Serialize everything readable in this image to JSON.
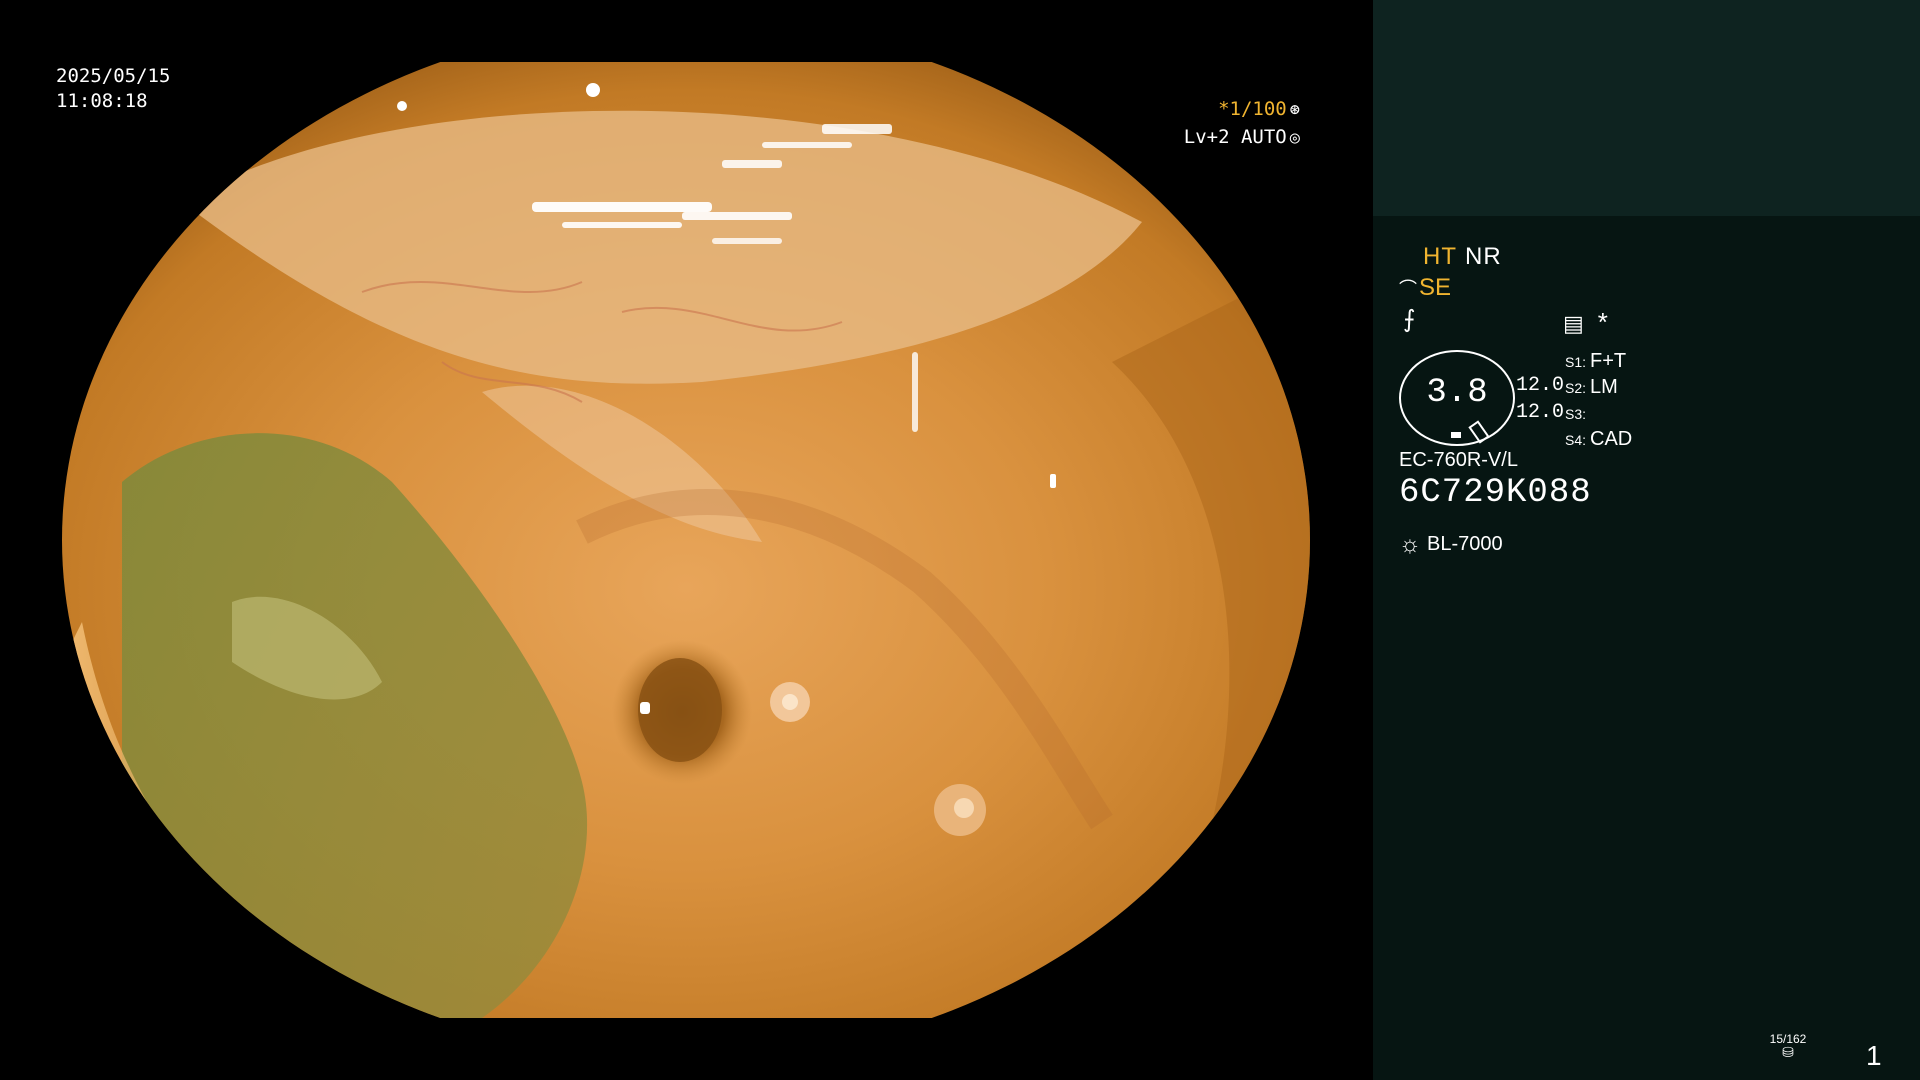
{
  "overlay": {
    "date": "2025/05/15",
    "time": "11:08:18",
    "shutter": "*1/100",
    "shutter_icon": "shutter-icon",
    "level": "Lv+2 AUTO",
    "level_icon": "iris-icon"
  },
  "panel": {
    "mode_ht": "HT",
    "mode_nr": "NR",
    "mode_se": "SE",
    "gauge_value": "3.8",
    "values": [
      "12.0",
      "12.0"
    ],
    "slots": [
      {
        "key": "S1:",
        "value": "F+T"
      },
      {
        "key": "S2:",
        "value": "LM"
      },
      {
        "key": "S3:",
        "value": ""
      },
      {
        "key": "S4:",
        "value": "CAD"
      }
    ],
    "scope_model": "EC-760R-V/L",
    "serial": "6C729K088",
    "light_source": "BL-7000",
    "image_counter": "15/162",
    "page_number": "1"
  },
  "colors": {
    "accent": "#f0b430",
    "panel_bg": "#061512",
    "panel_top_bg": "#0e2320"
  }
}
